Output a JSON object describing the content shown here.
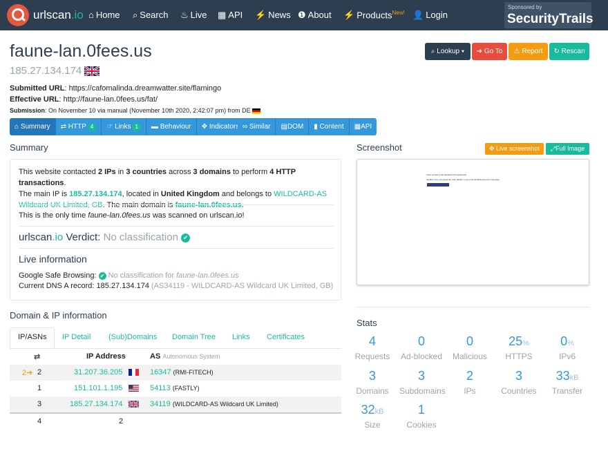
{
  "nav": {
    "brand_main": "urlscan",
    "brand_io": ".io",
    "items": [
      {
        "icon": "home-icon",
        "glyph": "⌂",
        "label": "Home"
      },
      {
        "icon": "search-icon",
        "glyph": "⌕",
        "label": "Search"
      },
      {
        "icon": "fire-icon",
        "glyph": "♨",
        "label": "Live"
      },
      {
        "icon": "qr-icon",
        "glyph": "▦",
        "label": "API"
      },
      {
        "icon": "bolt-icon",
        "glyph": "⚡",
        "label": "News"
      },
      {
        "icon": "info-icon",
        "glyph": "❶",
        "label": "About"
      },
      {
        "icon": "products-icon",
        "glyph": "⚡",
        "label": "Products",
        "sup": "New!"
      },
      {
        "icon": "user-icon",
        "glyph": "👤",
        "label": "Login"
      }
    ],
    "sponsor_small": "Sponsored by",
    "sponsor_name": "SecurityTrails"
  },
  "header": {
    "title": "faune-lan.0fees.us",
    "ip": "185.27.134.174",
    "submitted_label": "Submitted URL",
    "submitted_url": ": https://cafomalinda.dreamwatter.site/flamingo",
    "effective_label": "Effective URL",
    "effective_url": ": http://faune-lan.0fees.us/fat/",
    "submission_label": "Submission",
    "submission_text": ": On November 10 via manual (November 10th 2020, 2:42:07 pm) from DE"
  },
  "actions": {
    "lookup": "Lookup ▾",
    "goto": "Go To",
    "report": "Report",
    "rescan": "Rescan"
  },
  "tabs1": [
    {
      "label": "Summary",
      "glyph": "⌂"
    },
    {
      "label": "HTTP",
      "glyph": "⇄",
      "badge": "4"
    },
    {
      "label": "Links",
      "glyph": "☞",
      "badge": "1"
    },
    {
      "label": "Behaviour",
      "glyph": "▬"
    },
    {
      "label": "Indicators",
      "glyph": "✥"
    }
  ],
  "tabs2": [
    {
      "label": "Similar",
      "glyph": "∞"
    },
    {
      "label": "DOM",
      "glyph": "▤"
    },
    {
      "label": "Content",
      "glyph": "▮"
    },
    {
      "label": "API",
      "glyph": "▦"
    }
  ],
  "summary": {
    "heading": "Summary",
    "p1_a": "This website contacted ",
    "p1_ips": "2 IPs",
    "p1_b": " in ",
    "p1_countries": "3 countries",
    "p1_c": " across ",
    "p1_domains": "3 domains",
    "p1_d": " to perform ",
    "p1_http": "4 HTTP transactions",
    "p1_e": ".",
    "p2_a": "The main IP is ",
    "p2_ip": "185.27.134.174",
    "p2_b": ", located in ",
    "p2_country": "United Kingdom",
    "p2_c": " and belongs to ",
    "p2_org": "WILDCARD-AS Wildcard UK Limited, GB",
    "p2_d": ". The main domain is ",
    "p2_domain": "faune-lan.0fees.us.",
    "only_a": "This is the only time ",
    "only_domain": "faune-lan.0fees.us",
    "only_b": " was scanned on urlscan.io!",
    "verdict_brand": "urlscan",
    "verdict_io": ".io",
    "verdict_label": " Verdict: ",
    "verdict_value": "No classification",
    "live_heading": "Live information",
    "gsb_label": "Google Safe Browsing: ",
    "gsb_value": "No classification for ",
    "gsb_domain": "faune-lan.0fees.us",
    "dns_label": "Current DNS A record: 185.27.134.174 ",
    "dns_value": "(AS34119 - WILDCARD-AS Wildcard UK Limited, GB)"
  },
  "screenshot": {
    "heading": "Screenshot",
    "live_btn": "Live screenshot",
    "full_btn": "Full Image",
    "line1": "Votre compte a été désactivé (bit approuvé).",
    "line2": "Veuillez vous connecter de votre fidélité, nous vous bénéficierons des nouvelles"
  },
  "domain_ip": {
    "heading": "Domain & IP information",
    "tabs": [
      "IP/ASNs",
      "IP Detail",
      "(Sub)Domains",
      "Domain Tree",
      "Links",
      "Certificates"
    ],
    "col_arrows": "⇄",
    "col_ip": "IP Address",
    "col_as": "AS",
    "col_as_sub": "Autonomous System",
    "rows": [
      {
        "count_a": "2",
        "count_b": "2",
        "ip": "31.207.36.205",
        "flag": "fr",
        "asn": "16347",
        "asname": "(RMI-FITECH)"
      },
      {
        "count_a": "",
        "count_b": "1",
        "ip": "151.101.1.195",
        "flag": "us",
        "asn": "54113",
        "asname": "(FASTLY)"
      },
      {
        "count_a": "",
        "count_b": "3",
        "ip": "185.27.134.174",
        "flag": "gb",
        "asn": "34119",
        "asname": "(WILDCARD-AS Wildcard UK Limited)"
      }
    ],
    "total_count": "4",
    "total_ips": "2"
  },
  "stats": {
    "heading": "Stats",
    "items": [
      {
        "value": "4",
        "unit": "",
        "label": "Requests"
      },
      {
        "value": "0",
        "unit": "",
        "label": "Ad-blocked"
      },
      {
        "value": "0",
        "unit": "",
        "label": "Malicious"
      },
      {
        "value": "25",
        "unit": "%",
        "label": "HTTPS"
      },
      {
        "value": "0",
        "unit": "%",
        "label": "IPv6"
      },
      {
        "value": "3",
        "unit": "",
        "label": "Domains"
      },
      {
        "value": "3",
        "unit": "",
        "label": "Subdomains"
      },
      {
        "value": "2",
        "unit": "",
        "label": "IPs"
      },
      {
        "value": "3",
        "unit": "",
        "label": "Countries"
      },
      {
        "value": "33",
        "unit": "kB",
        "label": "Transfer"
      },
      {
        "value": "32",
        "unit": "kB",
        "label": "Size"
      },
      {
        "value": "1",
        "unit": "",
        "label": "Cookies"
      }
    ]
  },
  "colors": {
    "navbar": "#2c3e50",
    "teal": "#18bc9c",
    "blue": "#3498db",
    "red": "#e74c3c",
    "orange": "#f39c12",
    "dark": "#2c3e50"
  }
}
